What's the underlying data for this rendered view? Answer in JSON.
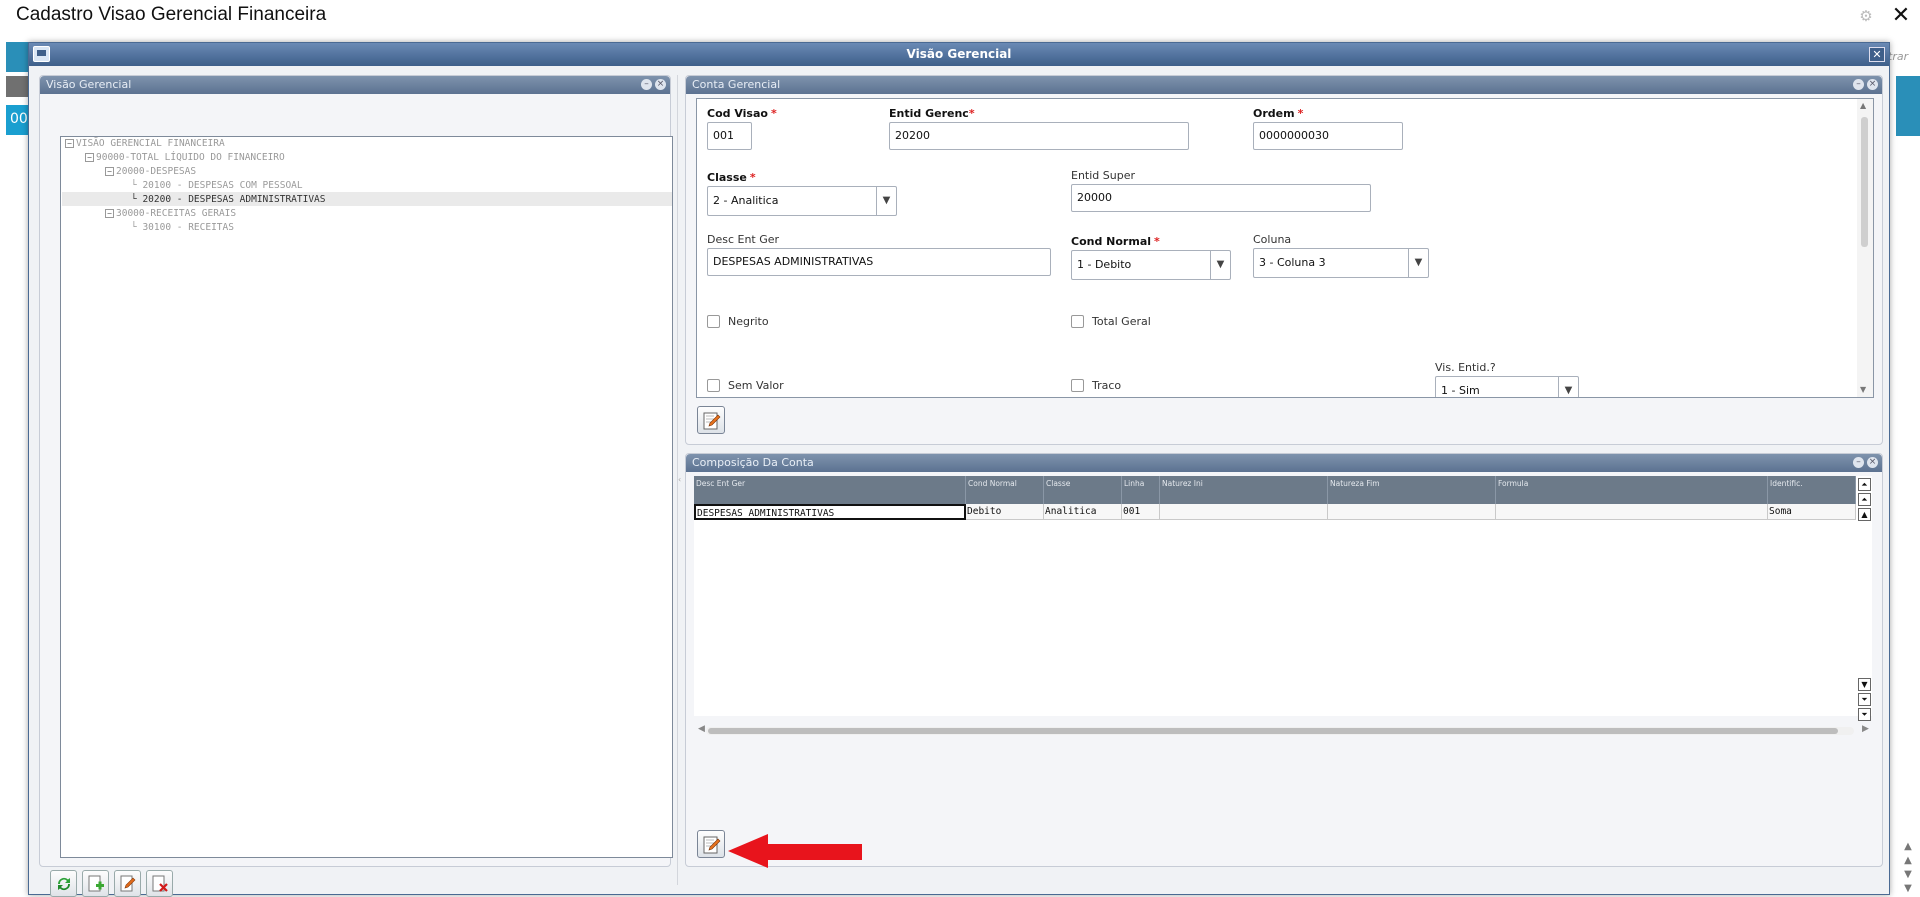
{
  "window": {
    "title": "Cadastro Visao Gerencial Financeira"
  },
  "background": {
    "left_value": "00",
    "filter_text": "trar"
  },
  "dialog": {
    "title": "Visão Gerencial"
  },
  "tree_panel": {
    "title": "Visão Gerencial",
    "nodes": [
      {
        "toggle": "−",
        "text": "VISÃO GERENCIAL FINANCEIRA"
      },
      {
        "toggle": "−",
        "text": "90000-TOTAL LÍQUIDO DO FINANCEIRO"
      },
      {
        "toggle": "−",
        "text": "20000-DESPESAS"
      },
      {
        "toggle": "",
        "text": "20100 - DESPESAS COM PESSOAL"
      },
      {
        "toggle": "",
        "text": "20200 - DESPESAS ADMINISTRATIVAS"
      },
      {
        "toggle": "−",
        "text": "30000-RECEITAS GERAIS"
      },
      {
        "toggle": "",
        "text": "30100 - RECEITAS"
      }
    ],
    "selected_index": 4
  },
  "account_panel": {
    "title": "Conta Gerencial",
    "fields": {
      "cod_visao": {
        "label": "Cod Visao",
        "value": "001"
      },
      "entid_gerenc": {
        "label": "Entid Gerenc",
        "value": "20200"
      },
      "ordem": {
        "label": "Ordem",
        "value": "0000000030"
      },
      "classe": {
        "label": "Classe",
        "value": "2 - Analitica"
      },
      "entid_super": {
        "label": "Entid Super",
        "value": "20000"
      },
      "desc_ent_ger": {
        "label": "Desc Ent Ger",
        "value": "DESPESAS ADMINISTRATIVAS"
      },
      "cond_normal": {
        "label": "Cond Normal",
        "value": "1 - Debito"
      },
      "coluna": {
        "label": "Coluna",
        "value": "3 - Coluna 3"
      },
      "negrito": {
        "label": "Negrito",
        "checked": false
      },
      "total_geral": {
        "label": "Total Geral",
        "checked": false
      },
      "vis_entid": {
        "label": "Vis. Entid.?",
        "value": "1 - Sim"
      },
      "sem_valor": {
        "label": "Sem Valor",
        "checked": false
      },
      "traco": {
        "label": "Traco",
        "checked": false
      }
    }
  },
  "composition_panel": {
    "title": "Composição Da Conta",
    "columns": [
      "Desc Ent Ger",
      "Cond Normal",
      "Classe",
      "Linha",
      "Naturez Ini",
      "Natureza Fim",
      "Formula",
      "Identific."
    ],
    "rows": [
      [
        "DESPESAS ADMINISTRATIVAS",
        "Debito",
        "Analitica",
        "001",
        "",
        "",
        "",
        "Soma"
      ]
    ]
  },
  "colors": {
    "dialog_title": "#3e5f8a",
    "panel_header": "#5c7291",
    "grid_header": "#6c7a89",
    "annotation_arrow": "#e8141c"
  },
  "icons": [
    "gear-icon",
    "close-icon",
    "refresh-icon",
    "add-icon",
    "edit-icon",
    "delete-icon",
    "red-arrow-annotation"
  ]
}
